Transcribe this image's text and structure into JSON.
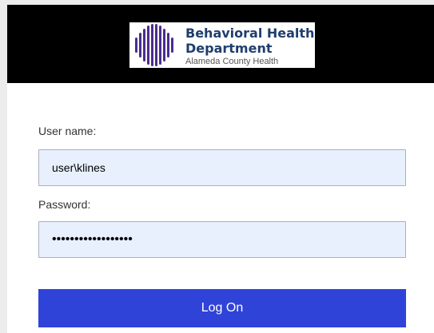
{
  "header": {
    "logo_title_line1": "Behavioral Health",
    "logo_title_line2": "Department",
    "logo_subtitle": "Alameda County Health",
    "logo_icon": "striped-oval-logo-icon",
    "background_color": "#000000",
    "logo_color": "#4a2d8f"
  },
  "form": {
    "username_label": "User name:",
    "username_value": "user\\klines",
    "password_label": "Password:",
    "password_value": "••••••••••••••••••",
    "submit_label": "Log On",
    "input_background": "#e8f0fe",
    "button_color": "#3043d8"
  }
}
